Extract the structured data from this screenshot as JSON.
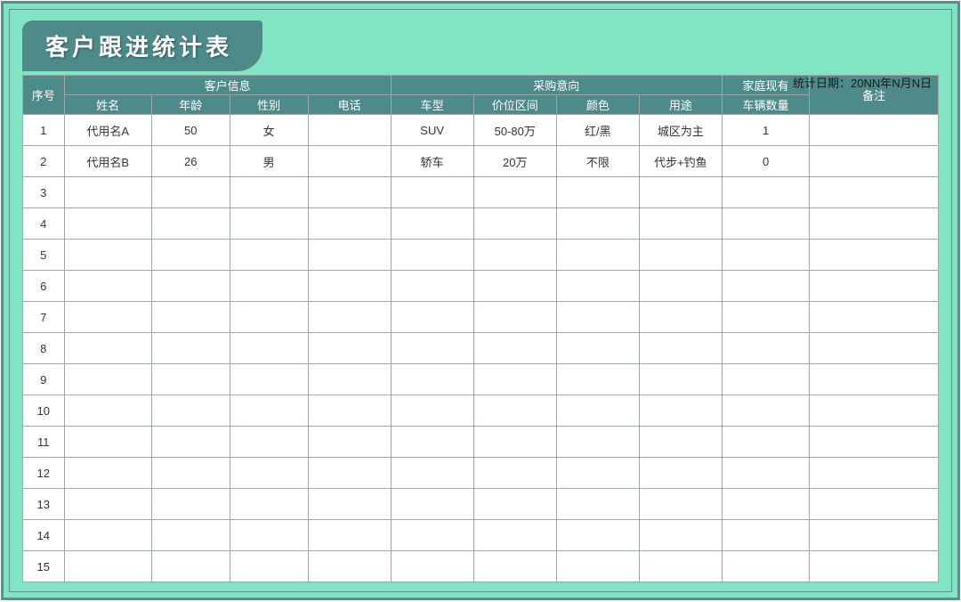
{
  "title": "客户跟进统计表",
  "date_label": "统计日期：20NN年N月N日",
  "headers": {
    "seq": "序号",
    "customer_info": "客户信息",
    "purchase_intent": "采购意向",
    "owned_title": "家庭现有",
    "owned_sub": "车辆数量",
    "note": "备注",
    "name": "姓名",
    "age": "年龄",
    "gender": "性别",
    "phone": "电话",
    "model": "车型",
    "price_range": "价位区间",
    "color": "颜色",
    "usage": "用途"
  },
  "rows": [
    {
      "seq": "1",
      "name": "代用名A",
      "age": "50",
      "gender": "女",
      "phone": "",
      "model": "SUV",
      "price": "50-80万",
      "color": "红/黑",
      "usage": "城区为主",
      "owned": "1",
      "note": ""
    },
    {
      "seq": "2",
      "name": "代用名B",
      "age": "26",
      "gender": "男",
      "phone": "",
      "model": "轿车",
      "price": "20万",
      "color": "不限",
      "usage": "代步+钓鱼",
      "owned": "0",
      "note": ""
    },
    {
      "seq": "3",
      "name": "",
      "age": "",
      "gender": "",
      "phone": "",
      "model": "",
      "price": "",
      "color": "",
      "usage": "",
      "owned": "",
      "note": ""
    },
    {
      "seq": "4",
      "name": "",
      "age": "",
      "gender": "",
      "phone": "",
      "model": "",
      "price": "",
      "color": "",
      "usage": "",
      "owned": "",
      "note": ""
    },
    {
      "seq": "5",
      "name": "",
      "age": "",
      "gender": "",
      "phone": "",
      "model": "",
      "price": "",
      "color": "",
      "usage": "",
      "owned": "",
      "note": ""
    },
    {
      "seq": "6",
      "name": "",
      "age": "",
      "gender": "",
      "phone": "",
      "model": "",
      "price": "",
      "color": "",
      "usage": "",
      "owned": "",
      "note": ""
    },
    {
      "seq": "7",
      "name": "",
      "age": "",
      "gender": "",
      "phone": "",
      "model": "",
      "price": "",
      "color": "",
      "usage": "",
      "owned": "",
      "note": ""
    },
    {
      "seq": "8",
      "name": "",
      "age": "",
      "gender": "",
      "phone": "",
      "model": "",
      "price": "",
      "color": "",
      "usage": "",
      "owned": "",
      "note": ""
    },
    {
      "seq": "9",
      "name": "",
      "age": "",
      "gender": "",
      "phone": "",
      "model": "",
      "price": "",
      "color": "",
      "usage": "",
      "owned": "",
      "note": ""
    },
    {
      "seq": "10",
      "name": "",
      "age": "",
      "gender": "",
      "phone": "",
      "model": "",
      "price": "",
      "color": "",
      "usage": "",
      "owned": "",
      "note": ""
    },
    {
      "seq": "11",
      "name": "",
      "age": "",
      "gender": "",
      "phone": "",
      "model": "",
      "price": "",
      "color": "",
      "usage": "",
      "owned": "",
      "note": ""
    },
    {
      "seq": "12",
      "name": "",
      "age": "",
      "gender": "",
      "phone": "",
      "model": "",
      "price": "",
      "color": "",
      "usage": "",
      "owned": "",
      "note": ""
    },
    {
      "seq": "13",
      "name": "",
      "age": "",
      "gender": "",
      "phone": "",
      "model": "",
      "price": "",
      "color": "",
      "usage": "",
      "owned": "",
      "note": ""
    },
    {
      "seq": "14",
      "name": "",
      "age": "",
      "gender": "",
      "phone": "",
      "model": "",
      "price": "",
      "color": "",
      "usage": "",
      "owned": "",
      "note": ""
    },
    {
      "seq": "15",
      "name": "",
      "age": "",
      "gender": "",
      "phone": "",
      "model": "",
      "price": "",
      "color": "",
      "usage": "",
      "owned": "",
      "note": ""
    }
  ]
}
